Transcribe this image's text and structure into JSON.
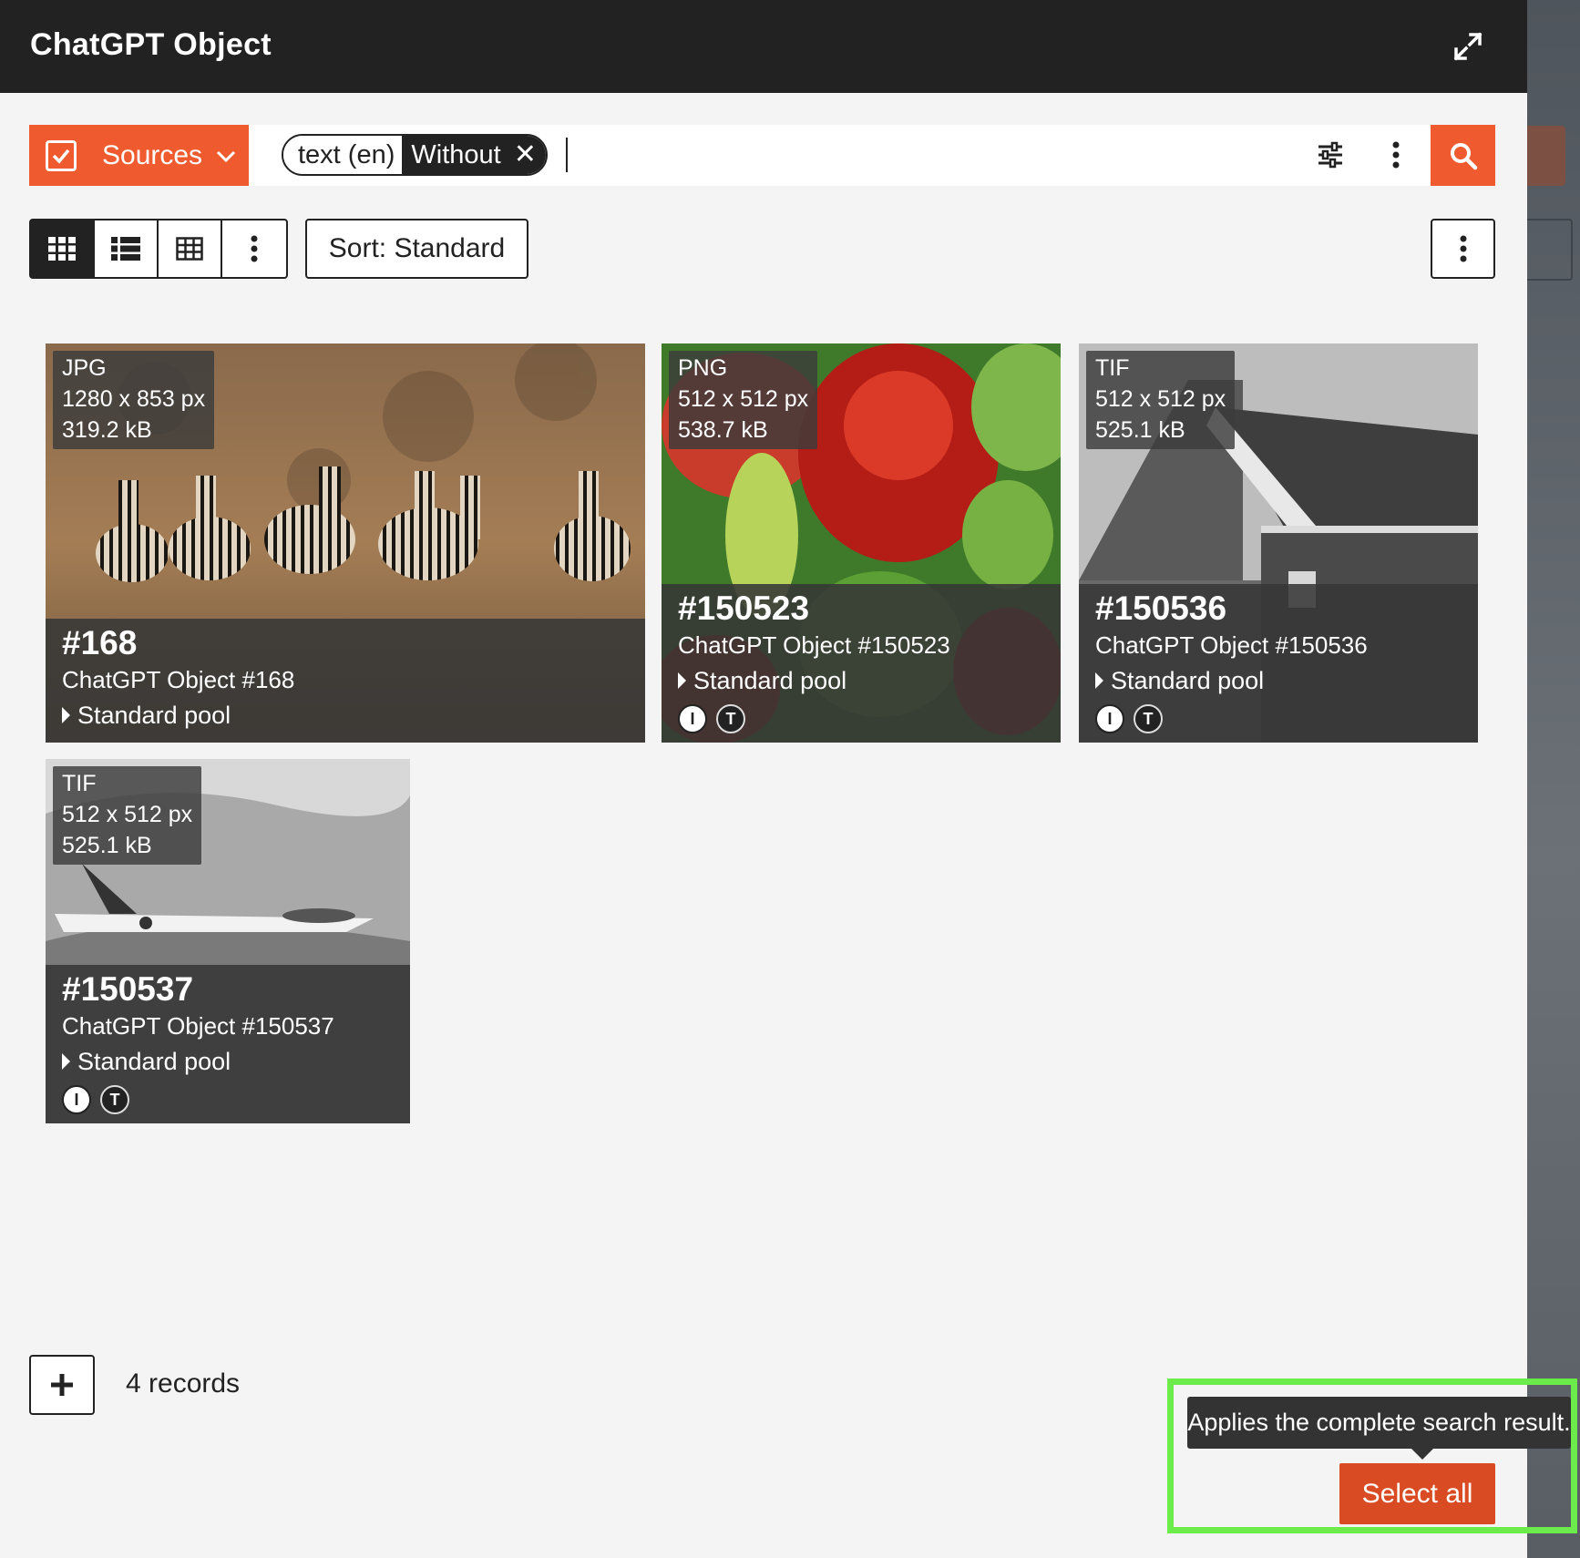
{
  "header": {
    "title": "ChatGPT Object"
  },
  "search": {
    "sources_label": "Sources",
    "chip_key": "text (en)",
    "chip_value": "Without",
    "chip_remove": "✕"
  },
  "toolbar": {
    "sort_label": "Sort: Standard"
  },
  "cards": [
    {
      "format": "JPG",
      "dims": "1280 x 853 px",
      "size": "319.2 kB",
      "id": "#168",
      "name": "ChatGPT Object #168",
      "pool": "Standard pool"
    },
    {
      "format": "PNG",
      "dims": "512 x 512 px",
      "size": "538.7 kB",
      "id": "#150523",
      "name": "ChatGPT Object #150523",
      "pool": "Standard pool",
      "badges": [
        "I",
        "T"
      ]
    },
    {
      "format": "TIF",
      "dims": "512 x 512 px",
      "size": "525.1 kB",
      "id": "#150536",
      "name": "ChatGPT Object #150536",
      "pool": "Standard pool",
      "badges": [
        "I",
        "T"
      ]
    },
    {
      "format": "TIF",
      "dims": "512 x 512 px",
      "size": "525.1 kB",
      "id": "#150537",
      "name": "ChatGPT Object #150537",
      "pool": "Standard pool",
      "badges": [
        "I",
        "T"
      ]
    }
  ],
  "footer": {
    "records": "4 records",
    "tooltip": "Applies the complete search result.",
    "select_all": "Select all"
  },
  "colors": {
    "accent": "#ef5a2e",
    "select_all": "#d94b22",
    "highlight": "#6bec4a",
    "header_bg": "#222222"
  },
  "icons": [
    "expand-icon",
    "checkbox-icon",
    "chevron-down-icon",
    "close-icon",
    "filter-sliders-icon",
    "kebab-icon",
    "search-icon",
    "grid-view-icon",
    "list-view-icon",
    "table-view-icon",
    "plus-icon"
  ]
}
